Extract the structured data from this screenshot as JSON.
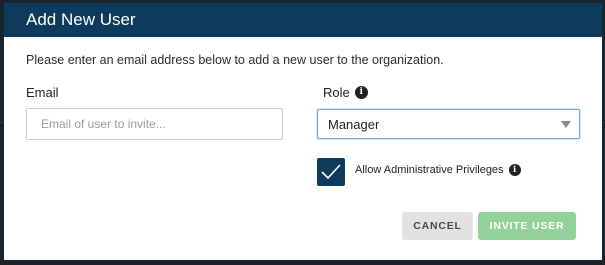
{
  "dialog": {
    "title": "Add New User",
    "intro": "Please enter an email address below to add a new user to the organization.",
    "email": {
      "label": "Email",
      "placeholder": "Email of user to invite...",
      "value": ""
    },
    "role": {
      "label": "Role",
      "info_icon": "info-icon",
      "selected": "Manager"
    },
    "admin_privileges": {
      "checked": true,
      "label": "Allow Administrative Privileges",
      "info_icon": "info-icon"
    },
    "buttons": {
      "cancel": "CANCEL",
      "invite": "INVITE USER"
    }
  },
  "colors": {
    "header_bg": "#0e3a5b",
    "checkbox_bg": "#0e3a5b",
    "invite_button_bg": "#92d19a",
    "cancel_button_bg": "#e2e2e2",
    "select_border": "#67a7d9"
  }
}
